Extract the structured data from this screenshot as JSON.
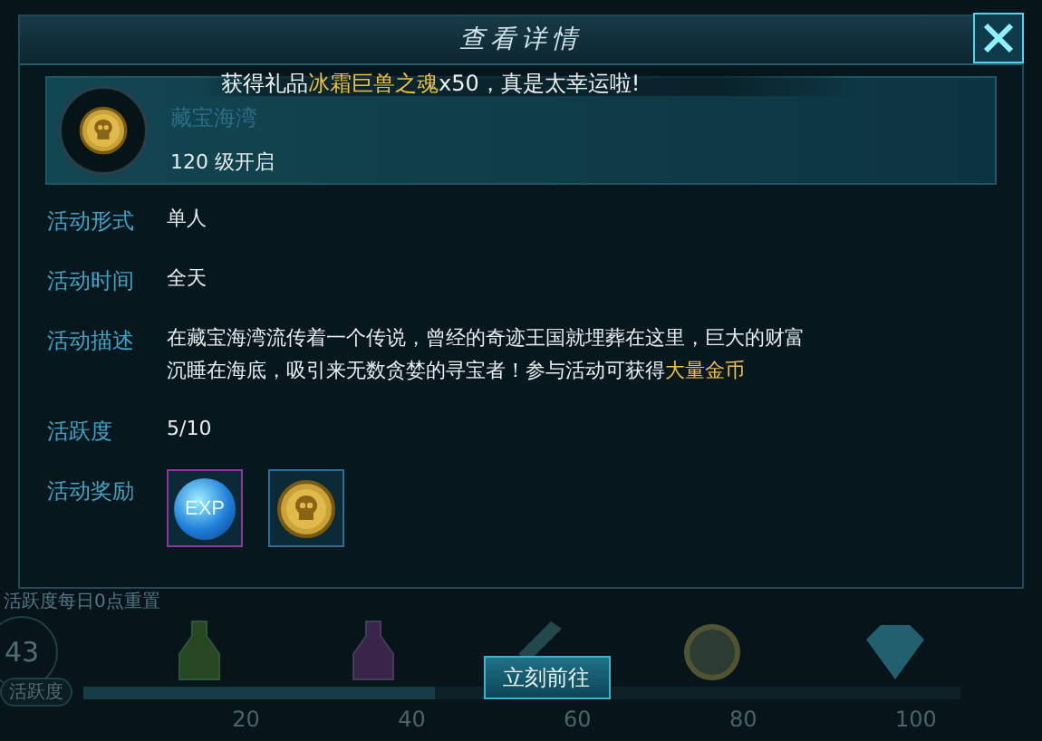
{
  "background": {
    "reset_note": "活跃度每日0点重置",
    "activity_points": "43",
    "activity_label": "活跃度",
    "progress": {
      "level": 0.4
    },
    "milestones": [
      "20",
      "40",
      "60",
      "80",
      "100"
    ]
  },
  "dialog": {
    "title": "查看详情",
    "activity": {
      "name": "藏宝海湾",
      "unlock": "120 级开启"
    },
    "toast": {
      "before": "获得礼品",
      "highlight": "冰霜巨兽之魂",
      "after": "x50，真是太幸运啦!"
    },
    "details": [
      {
        "label": "活动形式",
        "value": "单人"
      },
      {
        "label": "活动时间",
        "value": "全天"
      },
      {
        "label": "活动描述",
        "value": "在藏宝海湾流传着一个传说，曾经的奇迹王国就埋葬在这里，巨大的财富沉睡在海底，吸引来无数贪婪的寻宝者！参与活动可获得",
        "highlight": "大量金币"
      },
      {
        "label": "活跃度",
        "value": "5/10"
      }
    ],
    "rewards": {
      "label": "活动奖励",
      "items": [
        {
          "kind": "exp",
          "text": "EXP",
          "color": "#8a3a9a"
        },
        {
          "kind": "coin",
          "color": "#2f6f92"
        }
      ]
    },
    "button": "立刻前往"
  }
}
